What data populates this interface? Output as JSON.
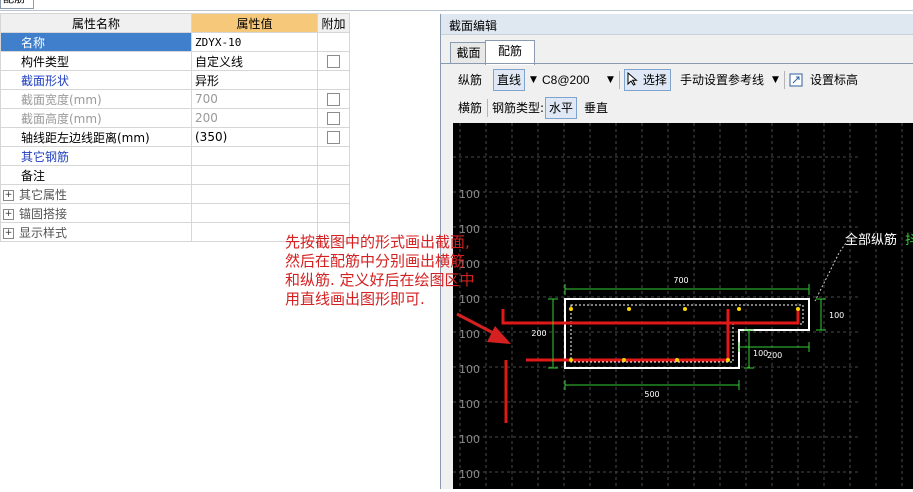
{
  "top_tab": {
    "label": "配筋"
  },
  "property_grid": {
    "headers": {
      "name": "属性名称",
      "value": "属性值",
      "extra": "附加"
    },
    "rows": [
      {
        "name": "名称",
        "value": "ZDYX-10"
      },
      {
        "name": "构件类型",
        "value": "自定义线"
      },
      {
        "name": "截面形状",
        "value": "异形"
      },
      {
        "name": "截面宽度(mm)",
        "value": "700"
      },
      {
        "name": "截面高度(mm)",
        "value": "200"
      },
      {
        "name": "轴线距左边线距离(mm)",
        "value": "(350)"
      },
      {
        "name": "其它钢筋",
        "value": ""
      },
      {
        "name": "备注",
        "value": ""
      },
      {
        "name": "其它属性",
        "value": ""
      },
      {
        "name": "锚固搭接",
        "value": ""
      },
      {
        "name": "显示样式",
        "value": ""
      }
    ],
    "expand_icon": "+"
  },
  "dialog": {
    "title": "截面编辑",
    "tabs": [
      "截面",
      "配筋"
    ],
    "active_tab": "配筋",
    "toolbar1": {
      "longitudinal_label": "纵筋",
      "line_button": "直线",
      "spec_value": "C8@200",
      "select_button": "选择",
      "manual_ref": "手动设置参考线",
      "set_elevation": "设置标高"
    },
    "toolbar2": {
      "transverse_label": "横筋",
      "rebar_type_label": "钢筋类型:",
      "horizontal": "水平",
      "vertical": "垂直"
    },
    "canvas": {
      "grid_label": "100",
      "rebar_callout": "全部纵筋",
      "rebar_callout_tail": "抖",
      "dims": {
        "top": "700",
        "left": "200",
        "right": "100",
        "step_v": "100",
        "step_h": "200",
        "bottom": "500"
      }
    }
  },
  "annotation": {
    "lines": [
      "先按截图中的形式画出截面,",
      "然后在配筋中分别画出横筋",
      "和纵筋. 定义好后在绘图区中",
      "用直线画出图形即可."
    ]
  },
  "colors": {
    "selected_row": "#3f7fcb",
    "header_value": "#f6c87a",
    "rebar": "#e01818",
    "dimension": "#33cc33",
    "annotation": "#d42020"
  }
}
